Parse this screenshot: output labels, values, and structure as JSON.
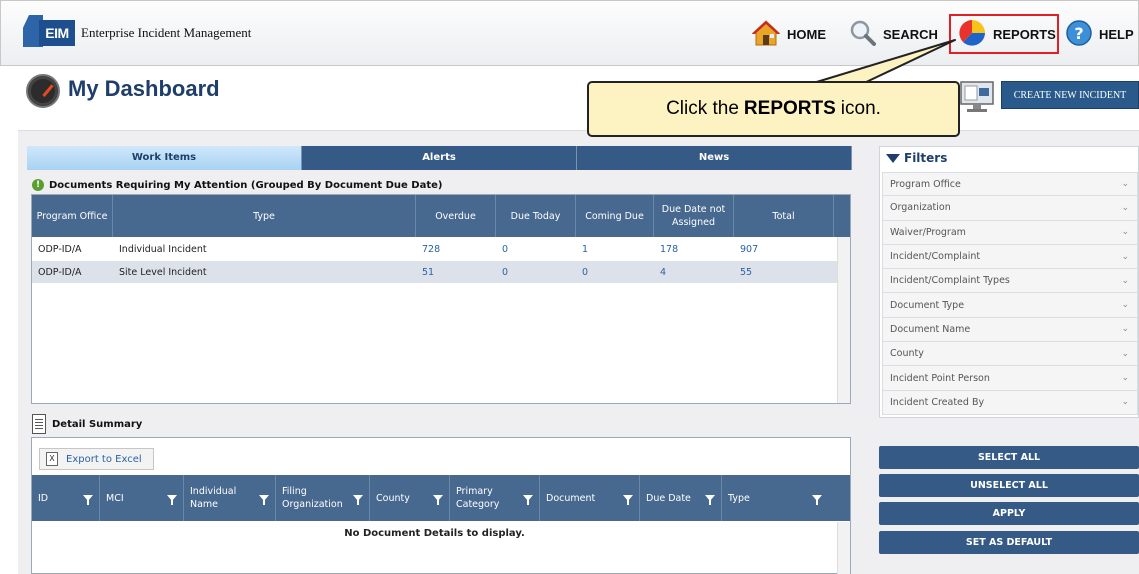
{
  "header": {
    "logo_text": "EIM",
    "app_title": "Enterprise Incident Management",
    "nav": {
      "home": "HOME",
      "search": "SEARCH",
      "reports": "REPORTS",
      "help": "HELP"
    }
  },
  "page": {
    "title": "My Dashboard",
    "create_button": "CREATE NEW INCIDENT"
  },
  "callout": {
    "before": "Click the",
    "bold": "REPORTS",
    "after": "icon."
  },
  "tabs": [
    {
      "label": "Work Items",
      "active": true
    },
    {
      "label": "Alerts",
      "active": false
    },
    {
      "label": "News",
      "active": false
    }
  ],
  "documents": {
    "heading": "Documents Requiring My Attention (Grouped By Document Due Date)",
    "columns": [
      "Program Office",
      "Type",
      "Overdue",
      "Due Today",
      "Coming Due",
      "Due Date not Assigned",
      "Total"
    ],
    "rows": [
      {
        "office": "ODP-ID/A",
        "type": "Individual Incident",
        "overdue": "728",
        "due_today": "0",
        "coming_due": "1",
        "not_assigned": "178",
        "total": "907"
      },
      {
        "office": "ODP-ID/A",
        "type": "Site Level Incident",
        "overdue": "51",
        "due_today": "0",
        "coming_due": "0",
        "not_assigned": "4",
        "total": "55"
      }
    ]
  },
  "detail": {
    "heading": "Detail Summary",
    "export_label": "Export to Excel",
    "columns": [
      "ID",
      "MCI",
      "Individual Name",
      "Filing Organization",
      "County",
      "Primary Category",
      "Document",
      "Due Date",
      "Type"
    ],
    "empty_message": "No Document Details to display."
  },
  "filters": {
    "title": "Filters",
    "items": [
      "Program Office",
      "Organization",
      "Waiver/Program",
      "Incident/Complaint",
      "Incident/Complaint Types",
      "Document Type",
      "Document Name",
      "County",
      "Incident Point Person",
      "Incident Created By"
    ]
  },
  "actions": {
    "select_all": "SELECT ALL",
    "unselect_all": "UNSELECT ALL",
    "apply": "APPLY",
    "set_default": "SET AS DEFAULT"
  },
  "colors": {
    "header_blue": "#345a85",
    "grid_header": "#48698f",
    "callout_bg": "#fdf3c2",
    "highlight_red": "#e31f26"
  }
}
